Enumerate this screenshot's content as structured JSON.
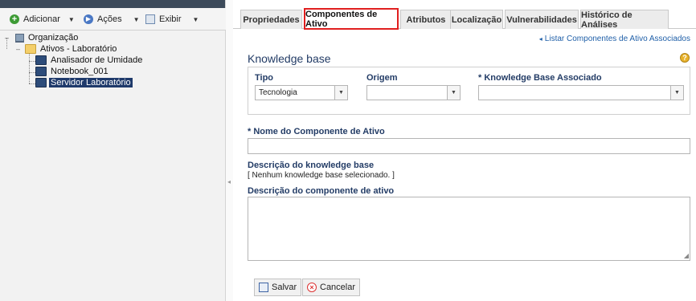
{
  "toolbar": {
    "add_label": "Adicionar",
    "actions_label": "Ações",
    "view_label": "Exibir"
  },
  "tree": {
    "root": "Organização",
    "folder": "Ativos - Laboratório",
    "items": [
      "Analisador de Umidade",
      "Notebook_001",
      "Servidor Laboratório"
    ],
    "selected_item": "Servidor Laboratório"
  },
  "tabs": [
    {
      "label": "Propriedades"
    },
    {
      "label": "Componentes de Ativo"
    },
    {
      "label": "Atributos"
    },
    {
      "label": "Localização"
    },
    {
      "label": "Vulnerabilidades"
    },
    {
      "label": "Histórico de Análises"
    }
  ],
  "active_tab": "Componentes de Ativo",
  "list_link": "Listar Componentes de Ativo Associados",
  "section_title": "Knowledge base",
  "fields": {
    "tipo": {
      "label": "Tipo",
      "value": "Tecnologia"
    },
    "origem": {
      "label": "Origem",
      "value": ""
    },
    "kb_associado": {
      "label": "* Knowledge Base Associado",
      "value": ""
    },
    "nome": {
      "label": "* Nome do Componente de Ativo",
      "value": ""
    },
    "descricao_kb": {
      "label": "Descrição do knowledge base",
      "value": "[ Nenhum knowledge base selecionado. ]"
    },
    "descricao_componente": {
      "label": "Descrição do componente de ativo",
      "value": ""
    }
  },
  "buttons": {
    "save": "Salvar",
    "cancel": "Cancelar"
  },
  "colors": {
    "active_tab_border": "#e01f1f",
    "label_blue": "#233c66",
    "selected_node_bg": "#1f3a6b"
  }
}
